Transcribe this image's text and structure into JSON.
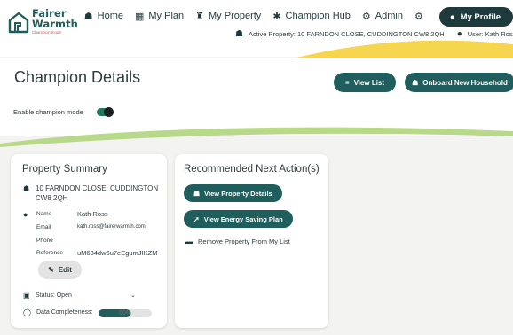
{
  "brand": {
    "name_line1": "Fairer",
    "name_line2": "Warmth",
    "tagline": "Champion mode",
    "logo_icon": "house-logo-icon"
  },
  "nav": {
    "items": [
      {
        "label": "Home",
        "icon": "home-icon"
      },
      {
        "label": "My Plan",
        "icon": "plan-icon"
      },
      {
        "label": "My Property",
        "icon": "property-icon"
      },
      {
        "label": "Champion Hub",
        "icon": "champion-icon"
      },
      {
        "label": "Admin",
        "icon": "admin-icon"
      }
    ],
    "settings_icon": "gear-icon",
    "profile_label": "My Profile"
  },
  "subnav": {
    "active_property": "Active Property: 10  FARNDON CLOSE, CUDDINGTON  CW8 2QH",
    "user": "User:  Kath Ross"
  },
  "page": {
    "title": "Champion Details",
    "view_list_label": "View List",
    "onboard_label": "Onboard New Household",
    "toggle_label": "Enable champion mode",
    "toggle_on": true
  },
  "summary": {
    "title": "Property Summary",
    "address": "10  FARNDON CLOSE, CUDDINGTON  CW8 2QH",
    "fields": [
      {
        "label": "Name",
        "value": "Kath Ross"
      },
      {
        "label": "Email",
        "value": "kath.ross@fairerwarmth.com"
      },
      {
        "label": "Phone",
        "value": ""
      },
      {
        "label": "Reference",
        "value": "uM684dw6u7eEgumJIKZM"
      }
    ],
    "edit_label": "Edit",
    "status_text": "Status:  Open",
    "completeness_label": "Data Completeness:",
    "completeness_value": "60%",
    "completeness_fraction": 0.6
  },
  "next_actions": {
    "title": "Recommended Next Action(s)",
    "view_property": "View Property Details",
    "view_plan": "View Energy Saving Plan",
    "remove": "Remove Property From My List"
  },
  "colors": {
    "primary": "#1f5e5c",
    "dark": "#1f3a3d",
    "accent_yellow": "#f6d64e",
    "accent_green": "#b9d98a"
  }
}
